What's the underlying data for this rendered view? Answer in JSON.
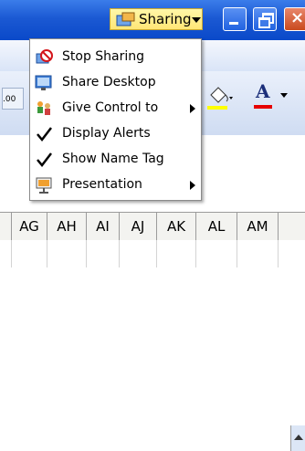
{
  "sharing_button": {
    "label": "Sharing"
  },
  "menu": {
    "items": [
      {
        "label": "Stop Sharing",
        "icon": "stop-sharing-icon"
      },
      {
        "label": "Share Desktop",
        "icon": "share-desktop-icon"
      },
      {
        "label": "Give Control to",
        "icon": "give-control-icon",
        "has_submenu": true
      },
      {
        "label": "Display Alerts",
        "icon": "checkmark-icon",
        "checked": true
      },
      {
        "label": "Show Name Tag",
        "icon": "checkmark-icon",
        "checked": true
      },
      {
        "label": "Presentation",
        "icon": "presentation-icon",
        "has_submenu": true
      }
    ]
  },
  "toolbar": {
    "restore_glyph": "В",
    "close_glyph": "×",
    "decimal_label": ".00",
    "font_color_letter": "A"
  },
  "spreadsheet": {
    "columns": [
      "AG",
      "AH",
      "AI",
      "AJ",
      "AK",
      "AL",
      "AM"
    ]
  },
  "colors": {
    "titlebar": "#1b59d3",
    "sharing_button_bg": "#ffe676",
    "font_color_underline": "#e60000"
  }
}
